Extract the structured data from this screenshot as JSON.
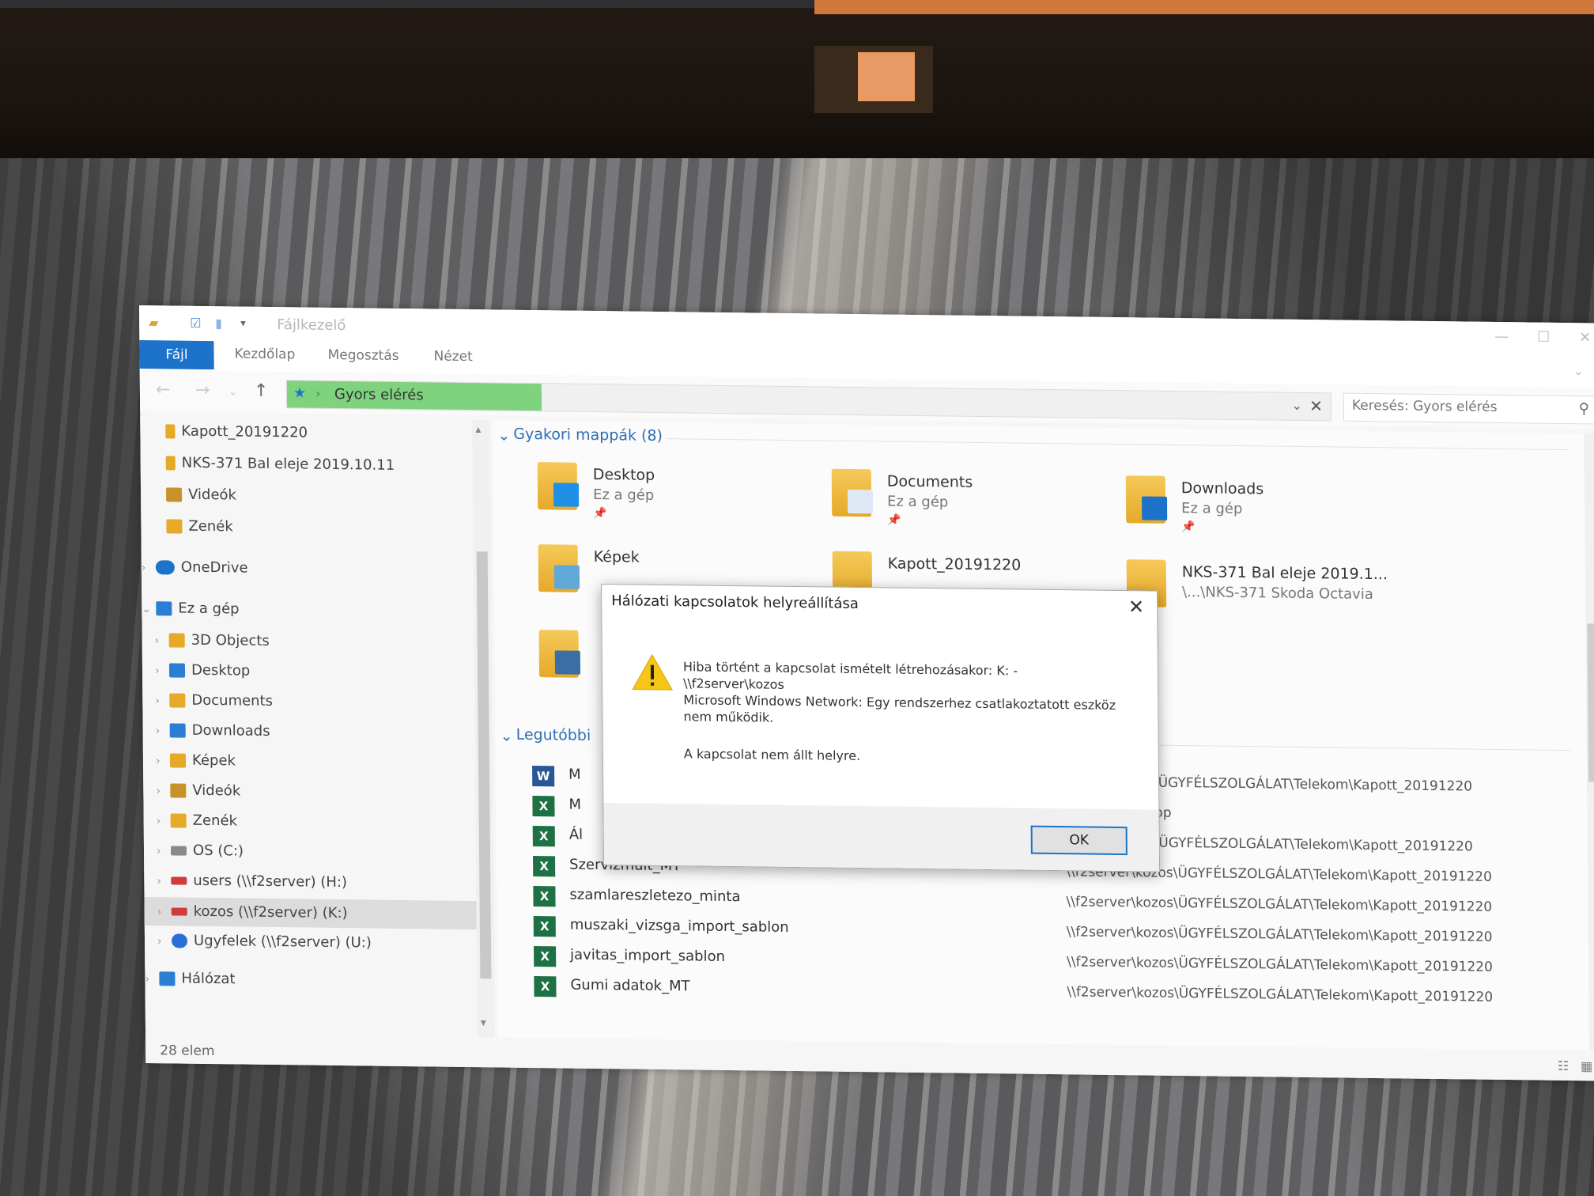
{
  "window": {
    "title": "Fájlkezelő"
  },
  "ribbon": {
    "tabs": [
      "Fájl",
      "Kezdőlap",
      "Megosztás",
      "Nézet"
    ]
  },
  "address": {
    "location": "Gyors elérés"
  },
  "search": {
    "placeholder": "Keresés: Gyors elérés"
  },
  "sidebar": {
    "items": [
      {
        "label": "Kapott_20191220",
        "icon": "folder-icon",
        "color": "#e6a928"
      },
      {
        "label": "NKS-371 Bal eleje 2019.10.11",
        "icon": "folder-icon",
        "color": "#e6a928"
      },
      {
        "label": "Videók",
        "icon": "videos-folder-icon",
        "color": "#c8922a"
      },
      {
        "label": "Zenék",
        "icon": "music-folder-icon",
        "color": "#e6a928"
      },
      {
        "label": "OneDrive",
        "icon": "cloud-icon",
        "color": "#1c73c9"
      },
      {
        "label": "Ez a gép",
        "icon": "computer-icon",
        "color": "#2a7fd4"
      },
      {
        "label": "3D Objects",
        "icon": "3d-objects-icon",
        "color": "#e6a928"
      },
      {
        "label": "Desktop",
        "icon": "desktop-folder-icon",
        "color": "#2a7fd4"
      },
      {
        "label": "Documents",
        "icon": "documents-folder-icon",
        "color": "#e6a928"
      },
      {
        "label": "Downloads",
        "icon": "downloads-folder-icon",
        "color": "#2a7fd4"
      },
      {
        "label": "Képek",
        "icon": "pictures-folder-icon",
        "color": "#e6a928"
      },
      {
        "label": "Videók",
        "icon": "videos-folder-icon",
        "color": "#c8922a"
      },
      {
        "label": "Zenék",
        "icon": "music-folder-icon",
        "color": "#e6a928"
      },
      {
        "label": "OS (C:)",
        "icon": "drive-icon",
        "color": "#8a8a8a"
      },
      {
        "label": "users (\\\\f2server) (H:)",
        "icon": "disconnected-drive-icon",
        "color": "#d23b3b"
      },
      {
        "label": "kozos (\\\\f2server) (K:)",
        "icon": "disconnected-drive-icon",
        "color": "#d23b3b"
      },
      {
        "label": "Ugyfelek (\\\\f2server) (U:)",
        "icon": "network-drive-icon",
        "color": "#2a6fd4"
      },
      {
        "label": "Hálózat",
        "icon": "network-icon",
        "color": "#2a7fd4"
      }
    ]
  },
  "frequent": {
    "header": "Gyakori mappák (8)",
    "folders": [
      {
        "name": "Desktop",
        "location": "Ez a gép",
        "badge": "#1e90e6"
      },
      {
        "name": "Documents",
        "location": "Ez a gép",
        "badge": "#dfe9f5"
      },
      {
        "name": "Downloads",
        "location": "Ez a gép",
        "badge": "#1c73c9"
      },
      {
        "name": "Képek",
        "location": "",
        "badge": "#5fa8d8"
      },
      {
        "name": "Kapott_20191220",
        "location": "",
        "badge": "#e6a928"
      },
      {
        "name": "NKS-371 Bal eleje 2019.1...",
        "location": "\\...\\NKS-371 Skoda Octavia",
        "badge": "#e6a928"
      },
      {
        "name": "",
        "location": "",
        "badge": "#3a6ea5"
      }
    ]
  },
  "recent": {
    "header": "Legutóbbi",
    "files": [
      {
        "name": "M",
        "type": "W",
        "color": "#2b5797",
        "path": "kozos\\ÜGYFÉLSZOLGÁLAT\\Telekom\\Kapott_20191220"
      },
      {
        "name": "M",
        "type": "X",
        "color": "#1e7145",
        "path": "Desktop"
      },
      {
        "name": "Ál",
        "type": "X",
        "color": "#1e7145",
        "path": "kozos\\ÜGYFÉLSZOLGÁLAT\\Telekom\\Kapott_20191220"
      },
      {
        "name": "Szervizmúlt_MT",
        "type": "X",
        "color": "#1e7145",
        "path": "\\\\f2server\\kozos\\ÜGYFÉLSZOLGÁLAT\\Telekom\\Kapott_20191220"
      },
      {
        "name": "szamlareszletezo_minta",
        "type": "X",
        "color": "#1e7145",
        "path": "\\\\f2server\\kozos\\ÜGYFÉLSZOLGÁLAT\\Telekom\\Kapott_20191220"
      },
      {
        "name": "muszaki_vizsga_import_sablon",
        "type": "X",
        "color": "#1e7145",
        "path": "\\\\f2server\\kozos\\ÜGYFÉLSZOLGÁLAT\\Telekom\\Kapott_20191220"
      },
      {
        "name": "javitas_import_sablon",
        "type": "X",
        "color": "#1e7145",
        "path": "\\\\f2server\\kozos\\ÜGYFÉLSZOLGÁLAT\\Telekom\\Kapott_20191220"
      },
      {
        "name": "Gumi adatok_MT",
        "type": "X",
        "color": "#1e7145",
        "path": "\\\\f2server\\kozos\\ÜGYFÉLSZOLGÁLAT\\Telekom\\Kapott_20191220"
      }
    ]
  },
  "status": {
    "count": "28 elem"
  },
  "dialog": {
    "title": "Hálózati kapcsolatok helyreállítása",
    "message_lines": [
      "Hiba történt a kapcsolat ismételt létrehozásakor: K: -",
      "\\\\f2server\\kozos",
      "Microsoft Windows Network: Egy rendszerhez csatlakoztatott eszköz",
      "nem működik."
    ],
    "result": "A kapcsolat nem állt helyre.",
    "ok_label": "OK"
  }
}
